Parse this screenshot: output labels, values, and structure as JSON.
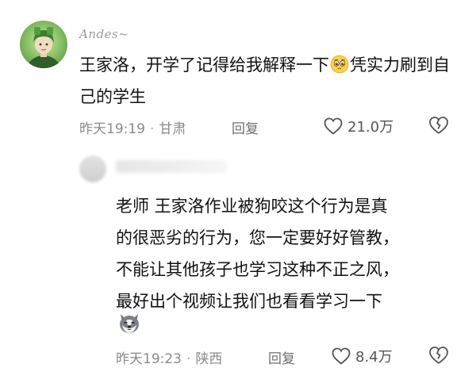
{
  "comment1": {
    "username": "Andes~",
    "text_before_emoji": "王家洛，开学了记得给我解释一下",
    "emoji": "pleading-face-emoji",
    "text_after_emoji": "凭实力刷到自己的学生",
    "time": "昨天19:19",
    "separator": "·",
    "location": "甘肃",
    "reply_label": "回复",
    "likes": "21.0万"
  },
  "comment2": {
    "text_lines": [
      "老师 王家洛作业被狗咬这个行为是真",
      "的很恶劣的行为，您一定要好好管教，",
      "不能让其他孩子也学习这种不正之风，",
      "最好出个视频让我们也看看学习一下"
    ],
    "emoji": "husky-dog-emoji",
    "time": "昨天19:23",
    "separator": "·",
    "location": "陕西",
    "reply_label": "回复",
    "likes": "8.4万"
  },
  "colors": {
    "text": "#111111",
    "meta": "#8a8a8a",
    "icon": "#555555",
    "avatar_green": "#8dc46a"
  }
}
